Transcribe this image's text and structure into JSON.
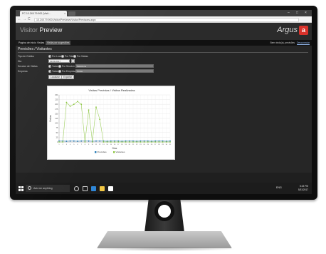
{
  "browser": {
    "tab_title": "PC 10.245.79.900 (Visit...",
    "url": "10.245.79.900/Visitor/Previews/Visitor/Previsoes.aspx",
    "tab_close": "×",
    "win_min": "–",
    "win_max": "□",
    "win_close": "×",
    "back": "←",
    "forward": "→",
    "reload": "C"
  },
  "app": {
    "title_light": "Visitor",
    "title_bold": "Preview",
    "brand": "Argus",
    "brand_badge": "a",
    "brand_color": "#d9322b"
  },
  "menu": {
    "items": [
      "Pagina de inicio",
      "Visitas",
      "Visita por sugestões"
    ],
    "active_index": 2,
    "user": "Bem vindo(a), previsões",
    "logout": "Desconectar"
  },
  "section": {
    "title": "Previsões / Visitantes"
  },
  "form": {
    "tipo_label": "Tipo de Gráfico",
    "tipo_options": [
      "Por Local",
      "Por Total",
      "Por Visitas"
    ],
    "tipo_selected": 0,
    "dia_label": "Dia",
    "dia_value": "01/01/2017",
    "secao_label": "Seccion de Visitas",
    "secao_options": [
      "Todos",
      "Por Seccion"
    ],
    "secao_selected": 0,
    "secao_value": "Selecione",
    "empresa_label": "Empresa",
    "empresa_options": [
      "Todos",
      "Por Empresa"
    ],
    "empresa_selected": 0,
    "empresa_value": "Todos",
    "btn_search": "Localizar",
    "btn_export": "Exportar"
  },
  "chart_data": {
    "type": "line",
    "title": "Visitas Previstas / Visitas Realizadas",
    "xlabel": "Dias",
    "ylabel": "Visitas",
    "ylim": [
      0,
      250
    ],
    "yticks": [
      0,
      25,
      50,
      75,
      100,
      125,
      150,
      175,
      200,
      225,
      250
    ],
    "x": [
      1,
      2,
      3,
      4,
      5,
      6,
      7,
      8,
      9,
      10,
      11,
      12,
      13,
      14,
      15,
      16,
      17,
      18,
      19,
      20,
      21,
      22,
      23,
      24,
      25,
      26,
      27,
      28,
      29,
      30,
      31
    ],
    "grid": true,
    "legend_position": "bottom",
    "series": [
      {
        "name": "Previsões",
        "color": "#1f77b4",
        "values": [
          5,
          5,
          4,
          5,
          5,
          4,
          5,
          5,
          5,
          4,
          5,
          5,
          5,
          4,
          5,
          5,
          5,
          4,
          5,
          5,
          5,
          4,
          5,
          5,
          5,
          4,
          5,
          5,
          5,
          4,
          5
        ]
      },
      {
        "name": "Visitantes",
        "color": "#8cc63f",
        "values": [
          0,
          0,
          210,
          190,
          200,
          215,
          200,
          0,
          170,
          0,
          185,
          120,
          0,
          0,
          0,
          0,
          0,
          0,
          0,
          0,
          0,
          0,
          0,
          0,
          0,
          0,
          0,
          0,
          0,
          0,
          0
        ]
      }
    ]
  },
  "taskbar": {
    "search_placeholder": "Ask me anything",
    "clock_time": "5:43 PM",
    "clock_date": "5/31/2017",
    "tray_text": "ENG"
  }
}
